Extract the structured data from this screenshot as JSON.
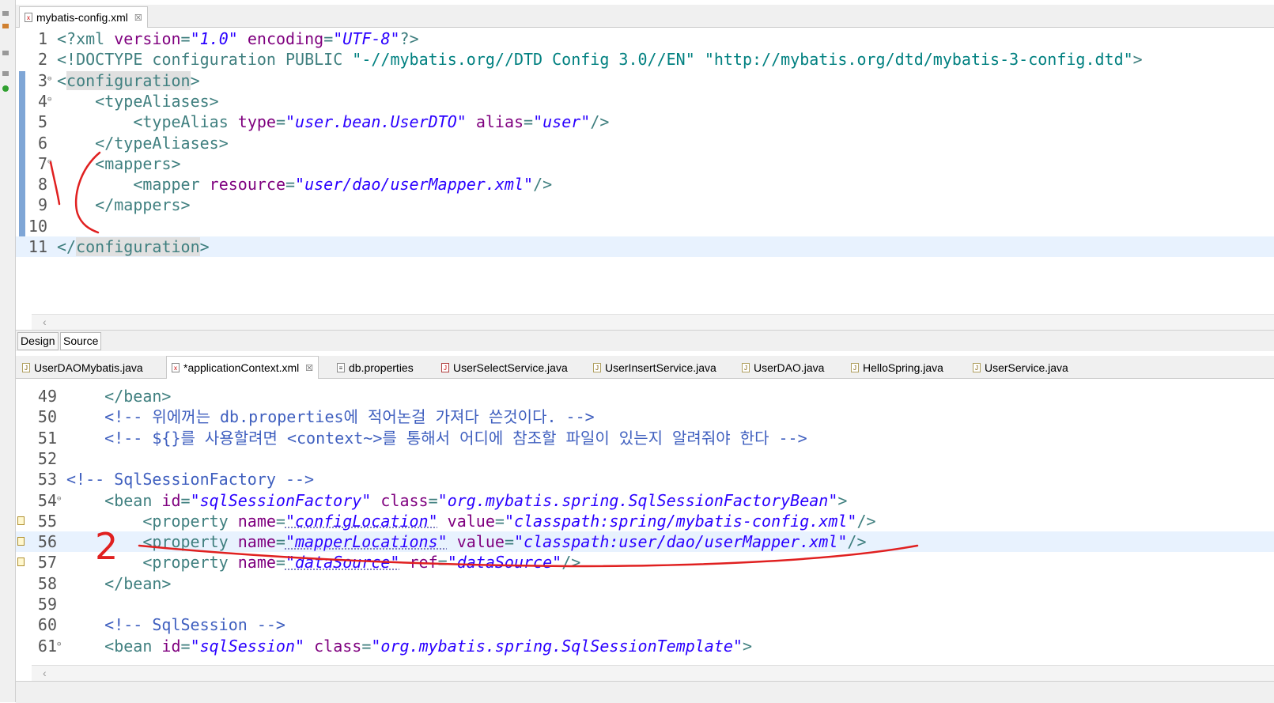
{
  "top_editor": {
    "tab": {
      "icon": "xml-file-icon",
      "label": "mybatis-config.xml",
      "close": "☒"
    },
    "lines": [
      {
        "num": "1",
        "parts": [
          [
            "t",
            "<?xml "
          ],
          [
            "a",
            "version"
          ],
          [
            "t",
            "="
          ],
          [
            "v",
            "\"1.0\""
          ],
          [
            "t",
            " "
          ],
          [
            "a",
            "encoding"
          ],
          [
            "t",
            "="
          ],
          [
            "v",
            "\"UTF-8\""
          ],
          [
            "t",
            "?>"
          ]
        ]
      },
      {
        "num": "2",
        "parts": [
          [
            "t",
            "<!DOCTYPE configuration "
          ],
          [
            "d",
            "PUBLIC"
          ],
          [
            "t",
            " "
          ],
          [
            "p",
            "\"-//mybatis.org//DTD Config 3.0//EN\""
          ],
          [
            "t",
            " "
          ],
          [
            "p",
            "\"http://mybatis.org/dtd/mybatis-3-config.dtd\""
          ],
          [
            "t",
            ">"
          ]
        ]
      },
      {
        "num": "3",
        "fold": "⊖",
        "parts": [
          [
            "t",
            "<"
          ],
          [
            "tsel",
            "configuration"
          ],
          [
            "t",
            ">"
          ]
        ]
      },
      {
        "num": "4",
        "fold": "⊖",
        "parts": [
          [
            "t",
            "    <typeAliases>"
          ]
        ]
      },
      {
        "num": "5",
        "parts": [
          [
            "t",
            "        <typeAlias "
          ],
          [
            "a",
            "type"
          ],
          [
            "t",
            "="
          ],
          [
            "v",
            "\"user.bean.UserDTO\""
          ],
          [
            "t",
            " "
          ],
          [
            "a",
            "alias"
          ],
          [
            "t",
            "="
          ],
          [
            "v",
            "\"user\""
          ],
          [
            "t",
            "/>"
          ]
        ]
      },
      {
        "num": "6",
        "parts": [
          [
            "t",
            "    </typeAliases>"
          ]
        ]
      },
      {
        "num": "7",
        "fold": "⊖",
        "parts": [
          [
            "t",
            "    <mappers>"
          ]
        ]
      },
      {
        "num": "8",
        "parts": [
          [
            "t",
            "        <mapper "
          ],
          [
            "a",
            "resource"
          ],
          [
            "t",
            "="
          ],
          [
            "v",
            "\"user/dao/userMapper.xml\""
          ],
          [
            "t",
            "/>"
          ]
        ]
      },
      {
        "num": "9",
        "parts": [
          [
            "t",
            "    </mappers>"
          ]
        ]
      },
      {
        "num": "10",
        "parts": []
      },
      {
        "num": "11",
        "parts": [
          [
            "t",
            "</"
          ],
          [
            "tsel",
            "configuration"
          ],
          [
            "t",
            ">"
          ]
        ]
      }
    ]
  },
  "mode_tabs": [
    "Design",
    "Source"
  ],
  "bottom_tabs": [
    {
      "label": "UserDAOMybatis.java",
      "icon": "java-file-icon"
    },
    {
      "label": "*applicationContext.xml",
      "icon": "xml-file-icon",
      "active": true,
      "close": "☒"
    },
    {
      "label": "db.properties",
      "icon": "properties-file-icon"
    },
    {
      "label": "UserSelectService.java",
      "icon": "java-error-file-icon"
    },
    {
      "label": "UserInsertService.java",
      "icon": "java-file-icon"
    },
    {
      "label": "UserDAO.java",
      "icon": "java-file-icon"
    },
    {
      "label": "HelloSpring.java",
      "icon": "java-file-icon"
    },
    {
      "label": "UserService.java",
      "icon": "java-file-icon"
    }
  ],
  "bottom_editor": {
    "lines": [
      {
        "num": "49",
        "parts": [
          [
            "t",
            "    </bean>"
          ]
        ]
      },
      {
        "num": "50",
        "parts": [
          [
            "c",
            "    <!-- 위에꺼는 db.properties에 적어논걸 가져다 쓴것이다. -->"
          ]
        ]
      },
      {
        "num": "51",
        "parts": [
          [
            "c",
            "    <!-- ${}를 사용할려면 <context~>를 통해서 어디에 참조할 파일이 있는지 알려줘야 한다 -->"
          ]
        ]
      },
      {
        "num": "52",
        "parts": []
      },
      {
        "num": "53",
        "parts": [
          [
            "c",
            "<!-- SqlSessionFactory -->"
          ]
        ]
      },
      {
        "num": "54",
        "fold": "⊖",
        "parts": [
          [
            "t",
            "    <bean "
          ],
          [
            "a",
            "id"
          ],
          [
            "t",
            "="
          ],
          [
            "v",
            "\"sqlSessionFactory\""
          ],
          [
            "t",
            " "
          ],
          [
            "a",
            "class"
          ],
          [
            "t",
            "="
          ],
          [
            "v",
            "\"org.mybatis.spring.SqlSessionFactoryBean\""
          ],
          [
            "t",
            ">"
          ]
        ]
      },
      {
        "num": "55",
        "marker": true,
        "parts": [
          [
            "t",
            "        <property "
          ],
          [
            "a",
            "name"
          ],
          [
            "t",
            "="
          ],
          [
            "vu",
            "\"configLocation\""
          ],
          [
            "t",
            " "
          ],
          [
            "a",
            "value"
          ],
          [
            "t",
            "="
          ],
          [
            "v",
            "\"classpath:spring/mybatis-config.xml\""
          ],
          [
            "t",
            "/>"
          ]
        ]
      },
      {
        "num": "56",
        "marker": true,
        "parts": [
          [
            "t",
            "        <property "
          ],
          [
            "a",
            "name"
          ],
          [
            "t",
            "="
          ],
          [
            "vu",
            "\"mapperLocations\""
          ],
          [
            "t",
            " "
          ],
          [
            "a",
            "value"
          ],
          [
            "t",
            "="
          ],
          [
            "v",
            "\"classpath:user/dao/userMapper.xml\""
          ],
          [
            "t",
            "/>"
          ]
        ]
      },
      {
        "num": "57",
        "marker": true,
        "parts": [
          [
            "t",
            "        <property "
          ],
          [
            "a",
            "name"
          ],
          [
            "t",
            "="
          ],
          [
            "vu",
            "\"dataSource\""
          ],
          [
            "t",
            " "
          ],
          [
            "a",
            "ref"
          ],
          [
            "t",
            "="
          ],
          [
            "v",
            "\"dataSource\""
          ],
          [
            "t",
            "/>"
          ]
        ]
      },
      {
        "num": "58",
        "parts": [
          [
            "t",
            "    </bean>"
          ]
        ]
      },
      {
        "num": "59",
        "parts": []
      },
      {
        "num": "60",
        "parts": [
          [
            "c",
            "    <!-- SqlSession -->"
          ]
        ]
      },
      {
        "num": "61",
        "fold": "⊖",
        "parts": [
          [
            "t",
            "    <bean "
          ],
          [
            "a",
            "id"
          ],
          [
            "t",
            "="
          ],
          [
            "v",
            "\"sqlSession\""
          ],
          [
            "t",
            " "
          ],
          [
            "a",
            "class"
          ],
          [
            "t",
            "="
          ],
          [
            "v",
            "\"org.mybatis.spring.SqlSessionTemplate\""
          ],
          [
            "t",
            ">"
          ]
        ]
      }
    ]
  },
  "annotations": {
    "label_2": "2"
  },
  "colors": {
    "tag": "#3f7f7f",
    "attr": "#7f007f",
    "value": "#2a00ff",
    "comment": "#3f5fbf",
    "ink": "#e02020"
  }
}
